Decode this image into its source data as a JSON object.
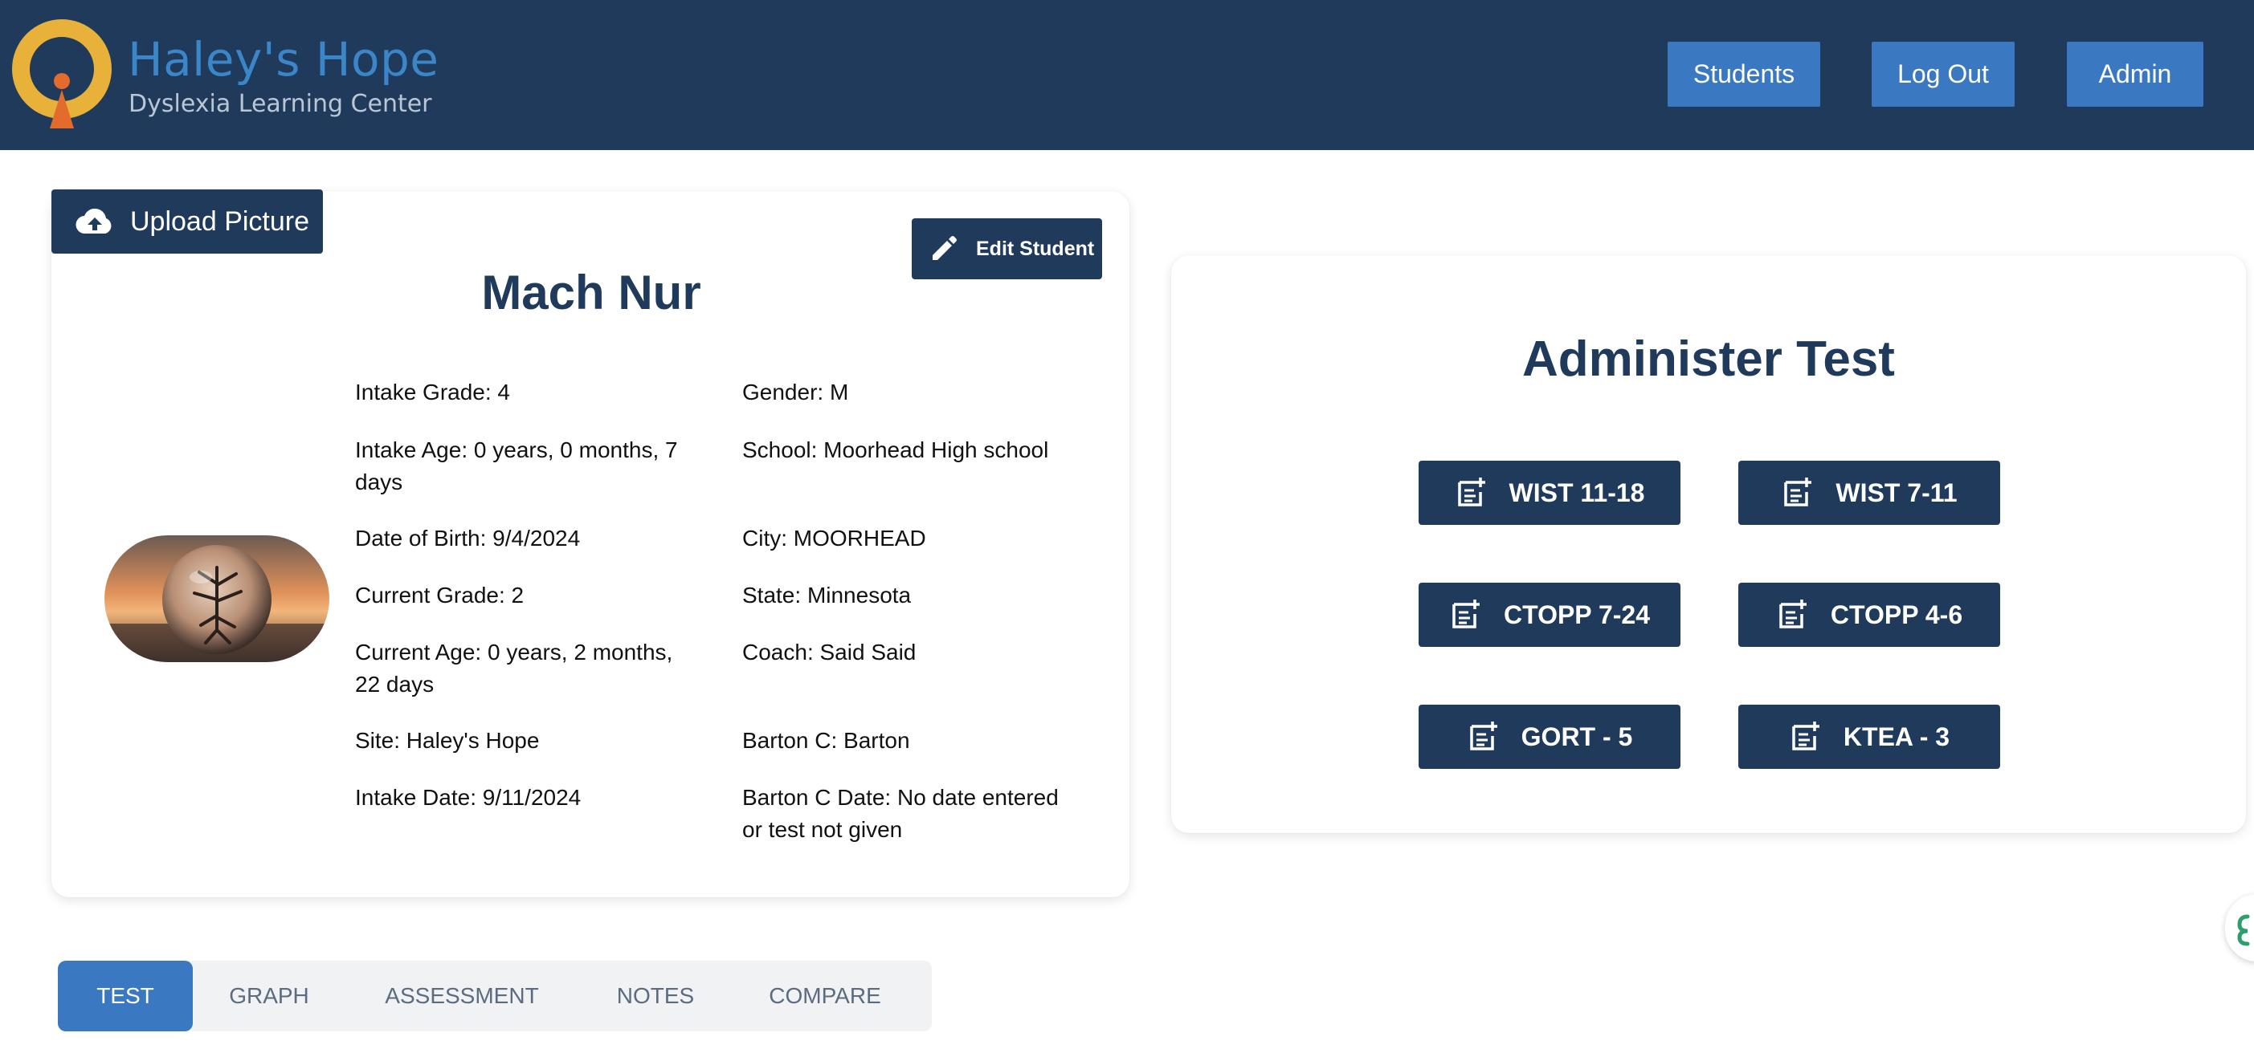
{
  "header": {
    "brand_name": "Haley's Hope",
    "brand_subtitle": "Dyslexia Learning Center",
    "nav": {
      "students": "Students",
      "logout": "Log Out",
      "admin": "Admin"
    },
    "colors": {
      "bar": "#1f3a5b",
      "button": "#3a78c2",
      "logo_ring": "#e8b13a",
      "logo_accent": "#e36b2c"
    }
  },
  "student": {
    "upload_label": "Upload Picture",
    "edit_label": "Edit Student",
    "name": "Mach Nur",
    "left_fields": [
      "Intake Grade: 4",
      "Intake Age: 0 years, 0 months, 7 days",
      "Date of Birth: 9/4/2024",
      "Current Grade: 2",
      "Current Age: 0 years, 2 months, 22 days",
      "Site: Haley's Hope",
      "Intake Date: 9/11/2024"
    ],
    "right_fields": [
      "Gender: M",
      "School: Moorhead High school",
      "City: MOORHEAD",
      "State: Minnesota",
      "Coach: Said Said",
      "Barton C: Barton",
      "Barton C Date: No date entered or test not given"
    ]
  },
  "administer": {
    "title": "Administer Test",
    "tests": [
      "WIST 11-18",
      "WIST 7-11",
      "CTOPP 7-24",
      "CTOPP 4-6",
      "GORT - 5",
      "KTEA - 3"
    ]
  },
  "tabs": [
    "TEST",
    "GRAPH",
    "ASSESSMENT",
    "NOTES",
    "COMPARE"
  ],
  "active_tab": "TEST"
}
